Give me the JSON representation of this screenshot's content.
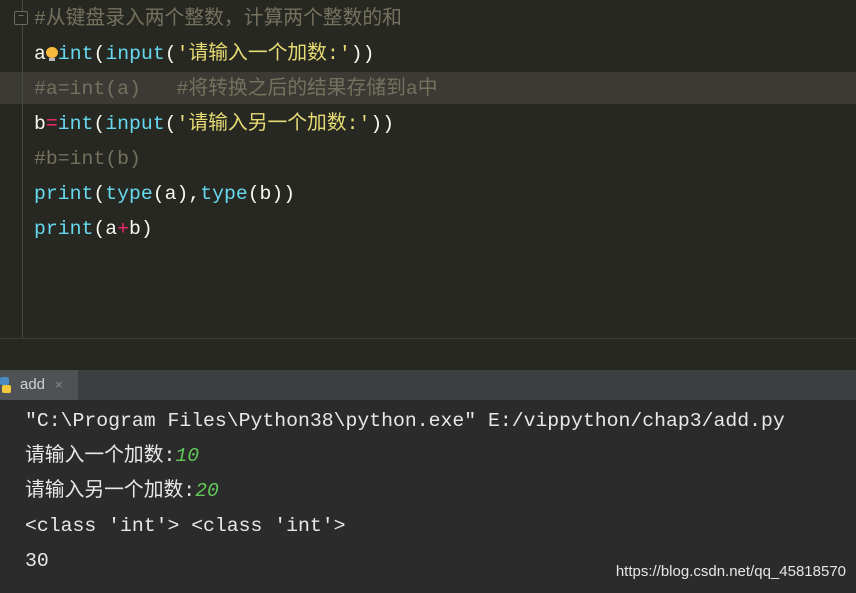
{
  "editor": {
    "lines": [
      {
        "comment": "#从键盘录入两个整数，计算两个整数的和"
      },
      {
        "var": "a",
        "op": "=",
        "fn1": "int",
        "p1": "(",
        "fn2": "input",
        "p2": "(",
        "str": "'请输入一个加数:'",
        "close": "))"
      },
      {
        "code": "#a=int(a)",
        "comment": "   #将转换之后的结果存储到a中"
      },
      {
        "var": "b",
        "op": "=",
        "fn1": "int",
        "p1": "(",
        "fn2": "input",
        "p2": "(",
        "str": "'请输入另一个加数:'",
        "close": "))"
      },
      {
        "comment": "#b=int(b)"
      },
      {
        "fn1": "print",
        "a1": "(",
        "fn2": "type",
        "a2": "(a),",
        "fn3": "type",
        "a3": "(b))"
      },
      {
        "fn1": "print",
        "a1": "(a",
        "op": "+",
        "a2": "b)"
      }
    ],
    "fold_icon": "minus-fold-icon",
    "intention_icon": "lightbulb-icon"
  },
  "run_panel": {
    "tab_label": "add",
    "tab_icon": "python-icon",
    "close_label": "×",
    "output": [
      {
        "text": "\"C:\\Program Files\\Python38\\python.exe\" E:/vippython/chap3/add.py"
      },
      {
        "text": "请输入一个加数:",
        "input": "10"
      },
      {
        "text": "请输入另一个加数:",
        "input": "20"
      },
      {
        "text": "<class 'int'> <class 'int'>"
      },
      {
        "text": "30"
      }
    ]
  },
  "watermark": "https://blog.csdn.net/qq_45818570",
  "colors": {
    "builtin": "#66d9ef",
    "string": "#e6db74",
    "comment": "#75715e",
    "operator": "#f92672",
    "user_input": "#62c85a"
  }
}
